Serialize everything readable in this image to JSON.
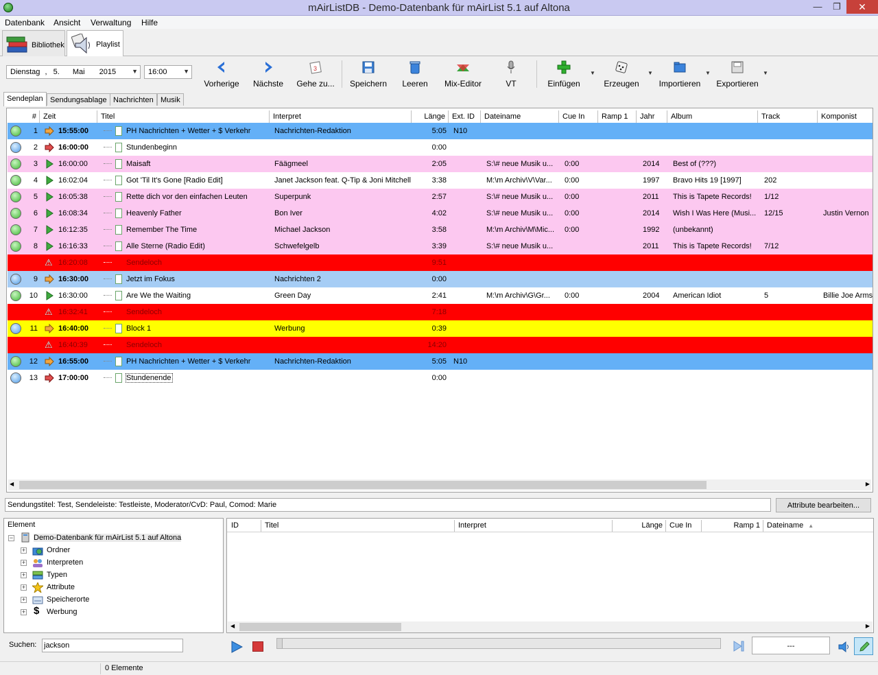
{
  "window": {
    "title": "mAirListDB - Demo-Datenbank für mAirList 5.1 auf Altona"
  },
  "menu": [
    "Datenbank",
    "Ansicht",
    "Verwaltung",
    "Hilfe"
  ],
  "main_tabs": [
    {
      "label": "Bibliothek"
    },
    {
      "label": "Playlist"
    }
  ],
  "toolbar": {
    "date": {
      "day_name": "Dienstag",
      "day": "5.",
      "month": "Mai",
      "year": "2015"
    },
    "time": "16:00",
    "buttons": [
      "Vorherige",
      "Nächste",
      "Gehe zu...",
      "Speichern",
      "Leeren",
      "Mix-Editor",
      "VT",
      "Einfügen",
      "Erzeugen",
      "Importieren",
      "Exportieren"
    ]
  },
  "sub_tabs": [
    "Sendeplan",
    "Sendungsablage",
    "Nachrichten",
    "Musik"
  ],
  "playlist_columns": [
    "#",
    "Zeit",
    "Titel",
    "Interpret",
    "Länge",
    "Ext. ID",
    "Dateiname",
    "Cue In",
    "Ramp 1",
    "Jahr",
    "Album",
    "Track",
    "Komponist"
  ],
  "playlist_rows": [
    {
      "num": "1",
      "time": "15:55:00",
      "title": "PH Nachrichten + Wetter + $ Verkehr",
      "artist": "Nachrichten-Redaktion",
      "length": "5:05",
      "ext_id": "N10",
      "file": "",
      "cue_in": "",
      "ramp": "",
      "year": "",
      "album": "",
      "track": "",
      "composer": "",
      "bg": "#64b0f7",
      "dot": "g",
      "icon": "fixed",
      "bold": true
    },
    {
      "num": "2",
      "time": "16:00:00",
      "title": "Stundenbeginn",
      "artist": "",
      "length": "0:00",
      "ext_id": "",
      "file": "",
      "cue_in": "",
      "ramp": "",
      "year": "",
      "album": "",
      "track": "",
      "composer": "",
      "bg": "#ffffff",
      "dot": "b",
      "icon": "hard",
      "bold": true
    },
    {
      "num": "3",
      "time": "16:00:00",
      "title": "Maisaft",
      "artist": "Fäägmeel",
      "length": "2:05",
      "ext_id": "",
      "file": "S:\\# neue Musik u...",
      "cue_in": "0:00",
      "ramp": "",
      "year": "2014",
      "album": "Best of (???)",
      "track": "",
      "composer": "",
      "bg": "#fcc8f0",
      "dot": "g",
      "icon": "play",
      "bold": false
    },
    {
      "num": "4",
      "time": "16:02:04",
      "title": "Got 'Til It's Gone [Radio Edit]",
      "artist": "Janet Jackson feat. Q-Tip & Joni Mitchell",
      "length": "3:38",
      "ext_id": "",
      "file": "M:\\m Archiv\\V\\Var...",
      "cue_in": "0:00",
      "ramp": "",
      "year": "1997",
      "album": "Bravo Hits 19 [1997]",
      "track": "202",
      "composer": "",
      "bg": "#ffffff",
      "dot": "g",
      "icon": "play",
      "bold": false
    },
    {
      "num": "5",
      "time": "16:05:38",
      "title": "Rette dich vor den einfachen Leuten",
      "artist": "Superpunk",
      "length": "2:57",
      "ext_id": "",
      "file": "S:\\# neue Musik u...",
      "cue_in": "0:00",
      "ramp": "",
      "year": "2011",
      "album": "This is Tapete Records!",
      "track": "1/12",
      "composer": "",
      "bg": "#fcc8f0",
      "dot": "g",
      "icon": "play",
      "bold": false
    },
    {
      "num": "6",
      "time": "16:08:34",
      "title": "Heavenly Father",
      "artist": "Bon Iver",
      "length": "4:02",
      "ext_id": "",
      "file": "S:\\# neue Musik u...",
      "cue_in": "0:00",
      "ramp": "",
      "year": "2014",
      "album": "Wish I Was Here (Musi...",
      "track": "12/15",
      "composer": "Justin Vernon",
      "bg": "#fcc8f0",
      "dot": "g",
      "icon": "play",
      "bold": false
    },
    {
      "num": "7",
      "time": "16:12:35",
      "title": "Remember The Time",
      "artist": "Michael Jackson",
      "length": "3:58",
      "ext_id": "",
      "file": "M:\\m Archiv\\M\\Mic...",
      "cue_in": "0:00",
      "ramp": "",
      "year": "1992",
      "album": "(unbekannt)",
      "track": "",
      "composer": "",
      "bg": "#fcc8f0",
      "dot": "g",
      "icon": "play",
      "bold": false
    },
    {
      "num": "8",
      "time": "16:16:33",
      "title": "Alle Sterne (Radio Edit)",
      "artist": "Schwefelgelb",
      "length": "3:39",
      "ext_id": "",
      "file": "S:\\# neue Musik u...",
      "cue_in": "",
      "ramp": "",
      "year": "2011",
      "album": "This is Tapete Records!",
      "track": "7/12",
      "composer": "",
      "bg": "#fcc8f0",
      "dot": "g",
      "icon": "play",
      "bold": false
    },
    {
      "num": "",
      "time": "16:20:08",
      "title": "Sendeloch",
      "artist": "",
      "length": "9:51",
      "ext_id": "",
      "file": "",
      "cue_in": "",
      "ramp": "",
      "year": "",
      "album": "",
      "track": "",
      "composer": "",
      "bg": "#ff0000",
      "dot": "",
      "icon": "warn",
      "bold": false
    },
    {
      "num": "9",
      "time": "16:30:00",
      "title": "Jetzt im Fokus",
      "artist": "Nachrichten 2",
      "length": "0:00",
      "ext_id": "",
      "file": "",
      "cue_in": "",
      "ramp": "",
      "year": "",
      "album": "",
      "track": "",
      "composer": "",
      "bg": "#a6cdf5",
      "dot": "b",
      "icon": "fixed",
      "bold": true
    },
    {
      "num": "10",
      "time": "16:30:00",
      "title": "Are We the Waiting",
      "artist": "Green Day",
      "length": "2:41",
      "ext_id": "",
      "file": "M:\\m Archiv\\G\\Gr...",
      "cue_in": "0:00",
      "ramp": "",
      "year": "2004",
      "album": "American Idiot",
      "track": "5",
      "composer": "Billie Joe Armst",
      "bg": "#ffffff",
      "dot": "g",
      "icon": "play",
      "bold": false
    },
    {
      "num": "",
      "time": "16:32:41",
      "title": "Sendeloch",
      "artist": "",
      "length": "7:18",
      "ext_id": "",
      "file": "",
      "cue_in": "",
      "ramp": "",
      "year": "",
      "album": "",
      "track": "",
      "composer": "",
      "bg": "#ff0000",
      "dot": "",
      "icon": "warn",
      "bold": false
    },
    {
      "num": "11",
      "time": "16:40:00",
      "title": "Block 1",
      "artist": "Werbung",
      "length": "0:39",
      "ext_id": "",
      "file": "",
      "cue_in": "",
      "ramp": "",
      "year": "",
      "album": "",
      "track": "",
      "composer": "",
      "bg": "#ffff00",
      "dot": "b",
      "icon": "fixed",
      "bold": true
    },
    {
      "num": "",
      "time": "16:40:39",
      "title": "Sendeloch",
      "artist": "",
      "length": "14:20",
      "ext_id": "",
      "file": "",
      "cue_in": "",
      "ramp": "",
      "year": "",
      "album": "",
      "track": "",
      "composer": "",
      "bg": "#ff0000",
      "dot": "",
      "icon": "warn",
      "bold": false
    },
    {
      "num": "12",
      "time": "16:55:00",
      "title": "PH Nachrichten + Wetter + $ Verkehr",
      "artist": "Nachrichten-Redaktion",
      "length": "5:05",
      "ext_id": "N10",
      "file": "",
      "cue_in": "",
      "ramp": "",
      "year": "",
      "album": "",
      "track": "",
      "composer": "",
      "bg": "#64b0f7",
      "dot": "g",
      "icon": "fixed",
      "bold": true
    },
    {
      "num": "13",
      "time": "17:00:00",
      "title": "Stundenende",
      "artist": "",
      "length": "0:00",
      "ext_id": "",
      "file": "",
      "cue_in": "",
      "ramp": "",
      "year": "",
      "album": "",
      "track": "",
      "composer": "",
      "bg": "#ffffff",
      "dot": "b",
      "icon": "hard",
      "bold": true
    }
  ],
  "info_line": "Sendungstitel: Test, Sendeleiste: Testleiste, Moderator/CvD: Paul, Comod: Marie",
  "attr_button": "Attribute bearbeiten...",
  "tree": {
    "header": "Element",
    "root": "Demo-Datenbank für mAirList 5.1 auf Altona",
    "children": [
      "Ordner",
      "Interpreten",
      "Typen",
      "Attribute",
      "Speicherorte",
      "Werbung"
    ]
  },
  "lower_columns": [
    "ID",
    "Titel",
    "Interpret",
    "Länge",
    "Cue In",
    "Ramp 1",
    "Dateiname"
  ],
  "search": {
    "label": "Suchen:",
    "value": "jackson"
  },
  "player": {
    "time": "---"
  },
  "status": {
    "count": "0 Elemente"
  }
}
